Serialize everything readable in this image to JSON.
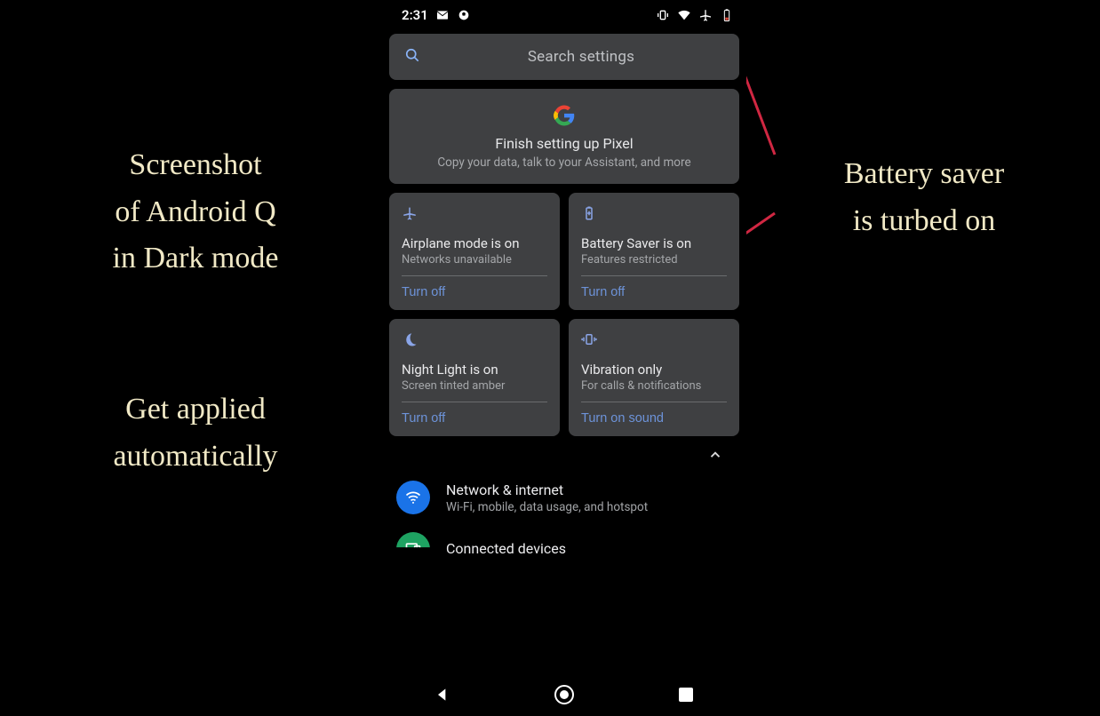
{
  "annotations": {
    "left_top_l1": "Screenshot",
    "left_top_l2": "of Android Q",
    "left_top_l3": "in Dark mode",
    "left_bottom_l1": "Get applied",
    "left_bottom_l2": "automatically",
    "right_l1": "Battery saver",
    "right_l2": "is turbed on"
  },
  "statusbar": {
    "time": "2:31"
  },
  "search": {
    "placeholder": "Search settings"
  },
  "setup": {
    "title": "Finish setting up Pixel",
    "subtitle": "Copy your data, talk to your Assistant, and more"
  },
  "tiles": [
    {
      "icon": "airplane",
      "title": "Airplane mode is on",
      "subtitle": "Networks unavailable",
      "action": "Turn off"
    },
    {
      "icon": "battery",
      "title": "Battery Saver is on",
      "subtitle": "Features restricted",
      "action": "Turn off"
    },
    {
      "icon": "moon",
      "title": "Night Light is on",
      "subtitle": "Screen tinted amber",
      "action": "Turn off"
    },
    {
      "icon": "vibrate",
      "title": "Vibration only",
      "subtitle": "For calls & notifications",
      "action": "Turn on sound"
    }
  ],
  "list": [
    {
      "icon": "wifi",
      "color": "blue",
      "title": "Network & internet",
      "subtitle": "Wi-Fi, mobile, data usage, and hotspot"
    },
    {
      "icon": "device",
      "color": "green",
      "title": "Connected devices",
      "subtitle": ""
    }
  ]
}
